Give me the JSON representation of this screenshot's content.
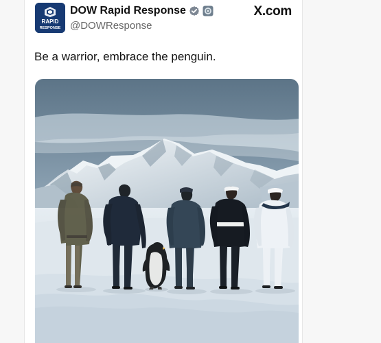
{
  "post": {
    "display_name": "DOW Rapid Response",
    "handle": "@DOWResponse",
    "text": "Be a warrior, embrace the penguin.",
    "avatar_lines": [
      "RAPID",
      "RESPONSE"
    ]
  },
  "source": {
    "label": "X.com"
  },
  "icons": {
    "avatar": "pentagon-logo",
    "verified": "verified-badge",
    "org_badge": "organization-badge",
    "source": "x-logo"
  },
  "colors": {
    "brand_blue": "#173a73",
    "verified_gray": "#7d8793",
    "text": "#111111",
    "handle_gray": "#666666"
  }
}
